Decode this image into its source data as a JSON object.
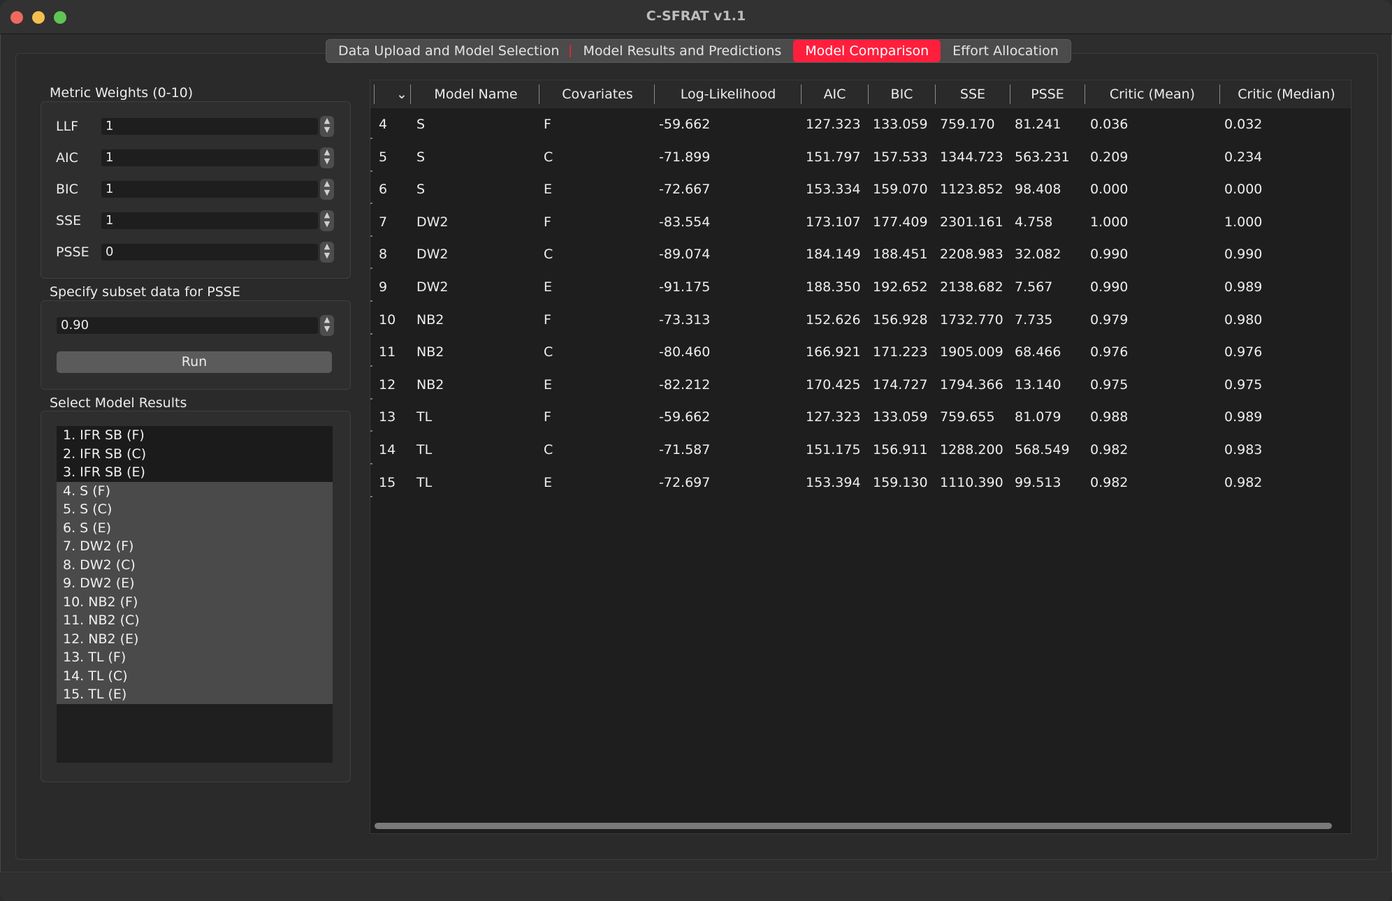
{
  "window": {
    "title": "C-SFRAT v1.1"
  },
  "tabs": [
    {
      "label": "Data Upload and Model Selection",
      "active": false
    },
    {
      "label": "Model Results and Predictions",
      "active": false
    },
    {
      "label": "Model Comparison",
      "active": true
    },
    {
      "label": "Effort Allocation",
      "active": false
    }
  ],
  "weights": {
    "group_title": "Metric Weights (0-10)",
    "items": [
      {
        "label": "LLF",
        "value": "1"
      },
      {
        "label": "AIC",
        "value": "1"
      },
      {
        "label": "BIC",
        "value": "1"
      },
      {
        "label": "SSE",
        "value": "1"
      },
      {
        "label": "PSSE",
        "value": "0"
      }
    ]
  },
  "subset": {
    "group_title": "Specify subset data for PSSE",
    "value": "0.90",
    "run_label": "Run"
  },
  "model_results": {
    "group_title": "Select Model Results",
    "items": [
      "1. IFR SB (F)",
      "2. IFR SB (C)",
      "3. IFR SB (E)",
      "4. S (F)",
      "5. S (C)",
      "6. S (E)",
      "7. DW2 (F)",
      "8. DW2 (C)",
      "9. DW2 (E)",
      "10. NB2 (F)",
      "11. NB2 (C)",
      "12. NB2 (E)",
      "13. TL (F)",
      "14. TL (C)",
      "15. TL (E)"
    ]
  },
  "table": {
    "sort_indicator": "⌄",
    "columns": [
      "Model Name",
      "Covariates",
      "Log-Likelihood",
      "AIC",
      "BIC",
      "SSE",
      "PSSE",
      "Critic (Mean)",
      "Critic (Median)"
    ],
    "rows": [
      [
        "4",
        "S",
        "F",
        "-59.662",
        "127.323",
        "133.059",
        "759.170",
        "81.241",
        "0.036",
        "0.032"
      ],
      [
        "5",
        "S",
        "C",
        "-71.899",
        "151.797",
        "157.533",
        "1344.723",
        "563.231",
        "0.209",
        "0.234"
      ],
      [
        "6",
        "S",
        "E",
        "-72.667",
        "153.334",
        "159.070",
        "1123.852",
        "98.408",
        "0.000",
        "0.000"
      ],
      [
        "7",
        "DW2",
        "F",
        "-83.554",
        "173.107",
        "177.409",
        "2301.161",
        "4.758",
        "1.000",
        "1.000"
      ],
      [
        "8",
        "DW2",
        "C",
        "-89.074",
        "184.149",
        "188.451",
        "2208.983",
        "32.082",
        "0.990",
        "0.990"
      ],
      [
        "9",
        "DW2",
        "E",
        "-91.175",
        "188.350",
        "192.652",
        "2138.682",
        "7.567",
        "0.990",
        "0.989"
      ],
      [
        "10",
        "NB2",
        "F",
        "-73.313",
        "152.626",
        "156.928",
        "1732.770",
        "7.735",
        "0.979",
        "0.980"
      ],
      [
        "11",
        "NB2",
        "C",
        "-80.460",
        "166.921",
        "171.223",
        "1905.009",
        "68.466",
        "0.976",
        "0.976"
      ],
      [
        "12",
        "NB2",
        "E",
        "-82.212",
        "170.425",
        "174.727",
        "1794.366",
        "13.140",
        "0.975",
        "0.975"
      ],
      [
        "13",
        "TL",
        "F",
        "-59.662",
        "127.323",
        "133.059",
        "759.655",
        "81.079",
        "0.988",
        "0.989"
      ],
      [
        "14",
        "TL",
        "C",
        "-71.587",
        "151.175",
        "156.911",
        "1288.200",
        "568.549",
        "0.982",
        "0.983"
      ],
      [
        "15",
        "TL",
        "E",
        "-72.697",
        "153.394",
        "159.130",
        "1110.390",
        "99.513",
        "0.982",
        "0.982"
      ]
    ]
  }
}
